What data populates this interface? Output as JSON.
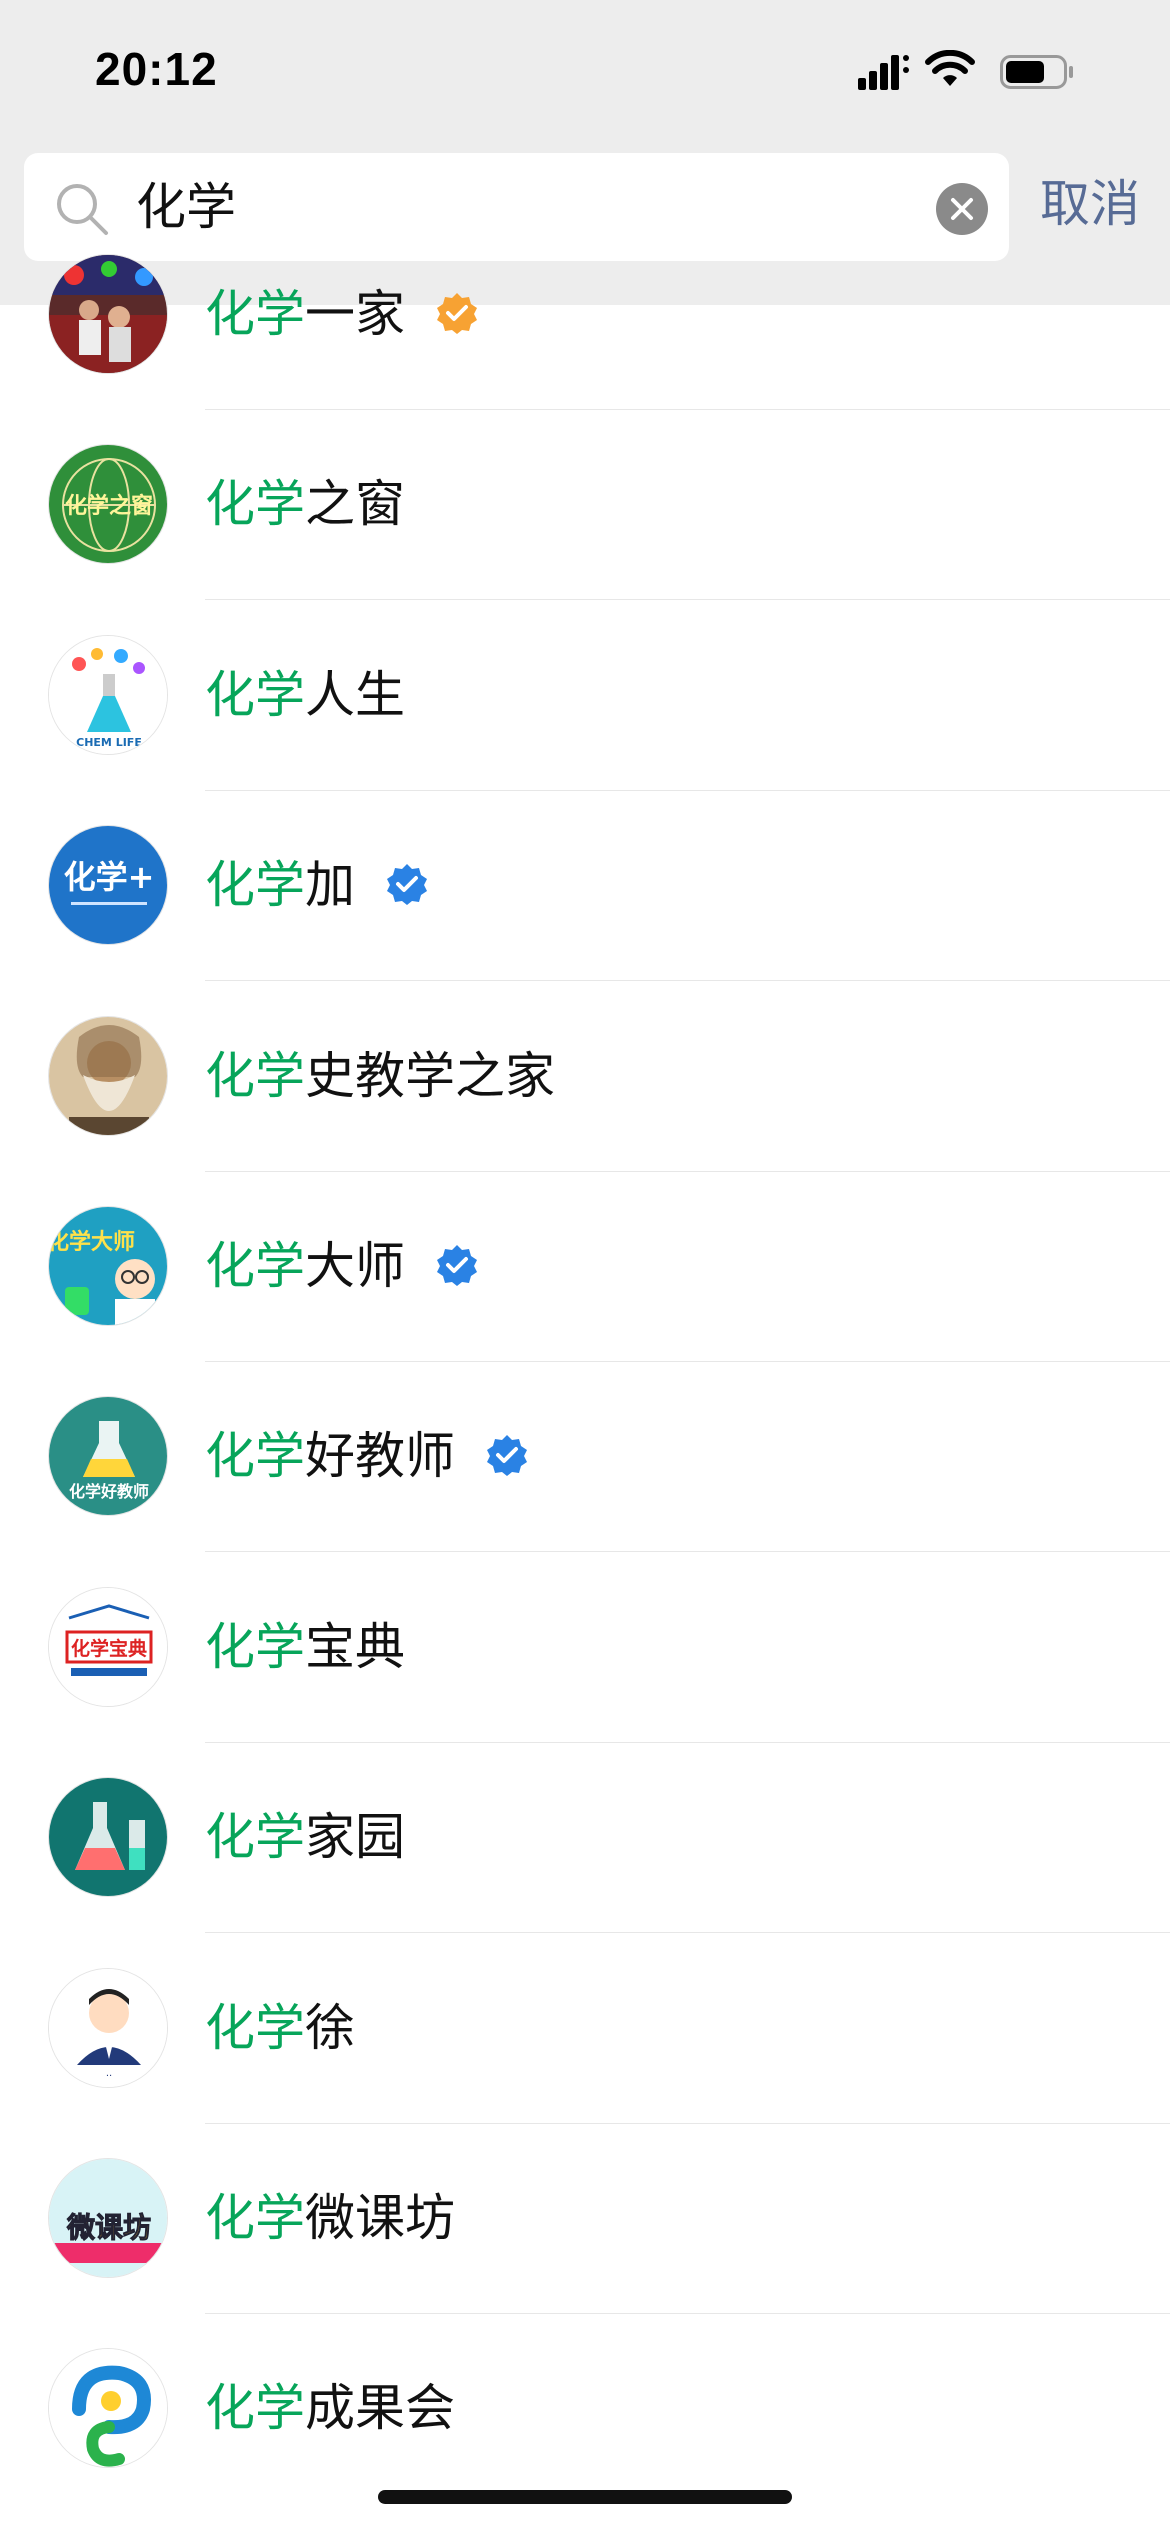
{
  "status_bar": {
    "time": "20:12"
  },
  "search": {
    "query": "化学",
    "cancel_label": "取消"
  },
  "highlight": "化学",
  "colors": {
    "highlight": "#07a55a",
    "verified_blue": "#2a82e4",
    "verified_orange": "#f7a233",
    "cancel": "#576b95"
  },
  "results": [
    {
      "prefix": "化学",
      "rest": "一家",
      "verified": "orange",
      "avatar": "photo-group-avatar"
    },
    {
      "prefix": "化学",
      "rest": "之窗",
      "verified": "none",
      "avatar": "green-globe-logo",
      "avatar_text": "化学之窗"
    },
    {
      "prefix": "化学",
      "rest": "人生",
      "verified": "none",
      "avatar": "flask-logo",
      "avatar_text": "CHEM LIFE"
    },
    {
      "prefix": "化学",
      "rest": "加",
      "verified": "blue",
      "avatar": "blue-logo",
      "avatar_text": "化学+"
    },
    {
      "prefix": "化学",
      "rest": "史教学之家",
      "verified": "none",
      "avatar": "bearded-portrait"
    },
    {
      "prefix": "化学",
      "rest": "大师",
      "verified": "blue",
      "avatar": "cartoon-scientist",
      "avatar_text": "化学大师"
    },
    {
      "prefix": "化学",
      "rest": "好教师",
      "verified": "blue",
      "avatar": "teal-flask-logo",
      "avatar_text": "化学好教师"
    },
    {
      "prefix": "化学",
      "rest": "宝典",
      "verified": "none",
      "avatar": "book-logo",
      "avatar_text": "化学宝典"
    },
    {
      "prefix": "化学",
      "rest": "家园",
      "verified": "none",
      "avatar": "lab-glassware-logo"
    },
    {
      "prefix": "化学",
      "rest": "徐",
      "verified": "none",
      "avatar": "cartoon-man"
    },
    {
      "prefix": "化学",
      "rest": "微课坊",
      "verified": "none",
      "avatar": "colorful-text-logo",
      "avatar_text": "微课坊"
    },
    {
      "prefix": "化学",
      "rest": "成果会",
      "verified": "none",
      "avatar": "swirl-logo"
    }
  ]
}
